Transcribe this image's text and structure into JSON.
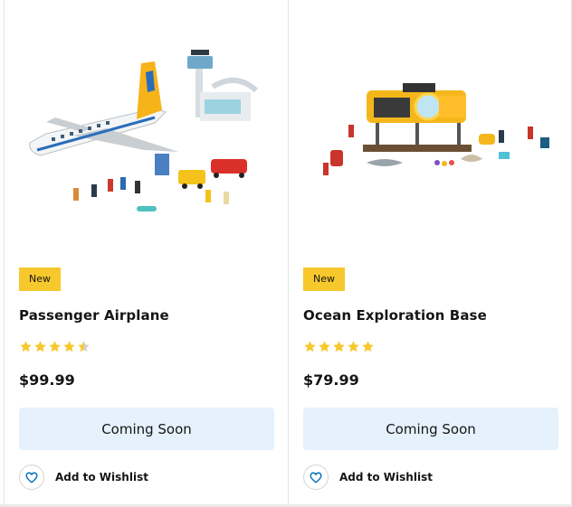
{
  "products": [
    {
      "badge": "New",
      "name": "Passenger Airplane",
      "rating": 4.5,
      "price": "$99.99",
      "cta_label": "Coming Soon",
      "wishlist_label": "Add to Wishlist",
      "image_icon": "airplane-set-image"
    },
    {
      "badge": "New",
      "name": "Ocean Exploration Base",
      "rating": 5,
      "price": "$79.99",
      "cta_label": "Coming Soon",
      "wishlist_label": "Add to Wishlist",
      "image_icon": "ocean-base-set-image"
    }
  ],
  "colors": {
    "badge": "#f6c82b",
    "star": "#f6c82b",
    "button_bg": "#e5f1fc",
    "heart": "#006cb7"
  }
}
